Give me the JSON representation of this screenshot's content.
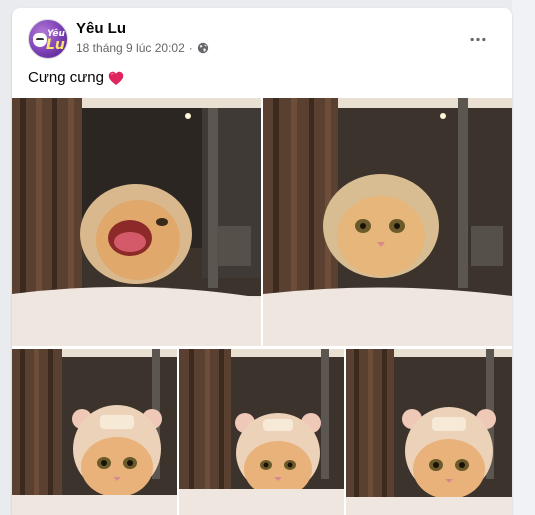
{
  "post": {
    "page_name": "Yêu Lu",
    "avatar_text_small": "Yêu",
    "avatar_text_big": "Lu",
    "timestamp": "18 tháng 9 lúc 20:02",
    "separator": "·",
    "privacy_icon": "globe-icon",
    "caption": "Cưng cưng",
    "caption_emoji": "heart-icon",
    "more_icon": "more-horizontal-icon"
  },
  "photos": [
    {
      "id": "photo-1",
      "subject": "cat-yawning-in-beige-hood",
      "hat": "plain-hood",
      "mood": "yawn"
    },
    {
      "id": "photo-2",
      "subject": "cat-in-beige-hood",
      "hat": "plain-hood",
      "mood": "calm"
    },
    {
      "id": "photo-3",
      "subject": "cat-in-bear-ears-hat",
      "hat": "bear-hat",
      "mood": "calm"
    },
    {
      "id": "photo-4",
      "subject": "cat-in-bear-ears-hat",
      "hat": "bear-hat",
      "mood": "calm"
    },
    {
      "id": "photo-5",
      "subject": "cat-in-bear-ears-hat",
      "hat": "bear-hat",
      "mood": "calm"
    }
  ],
  "colors": {
    "page_bg": "#e9ebee",
    "card_bg": "#ffffff",
    "text_primary": "#050505",
    "text_secondary": "#65676b",
    "heart": "#e0245e"
  }
}
